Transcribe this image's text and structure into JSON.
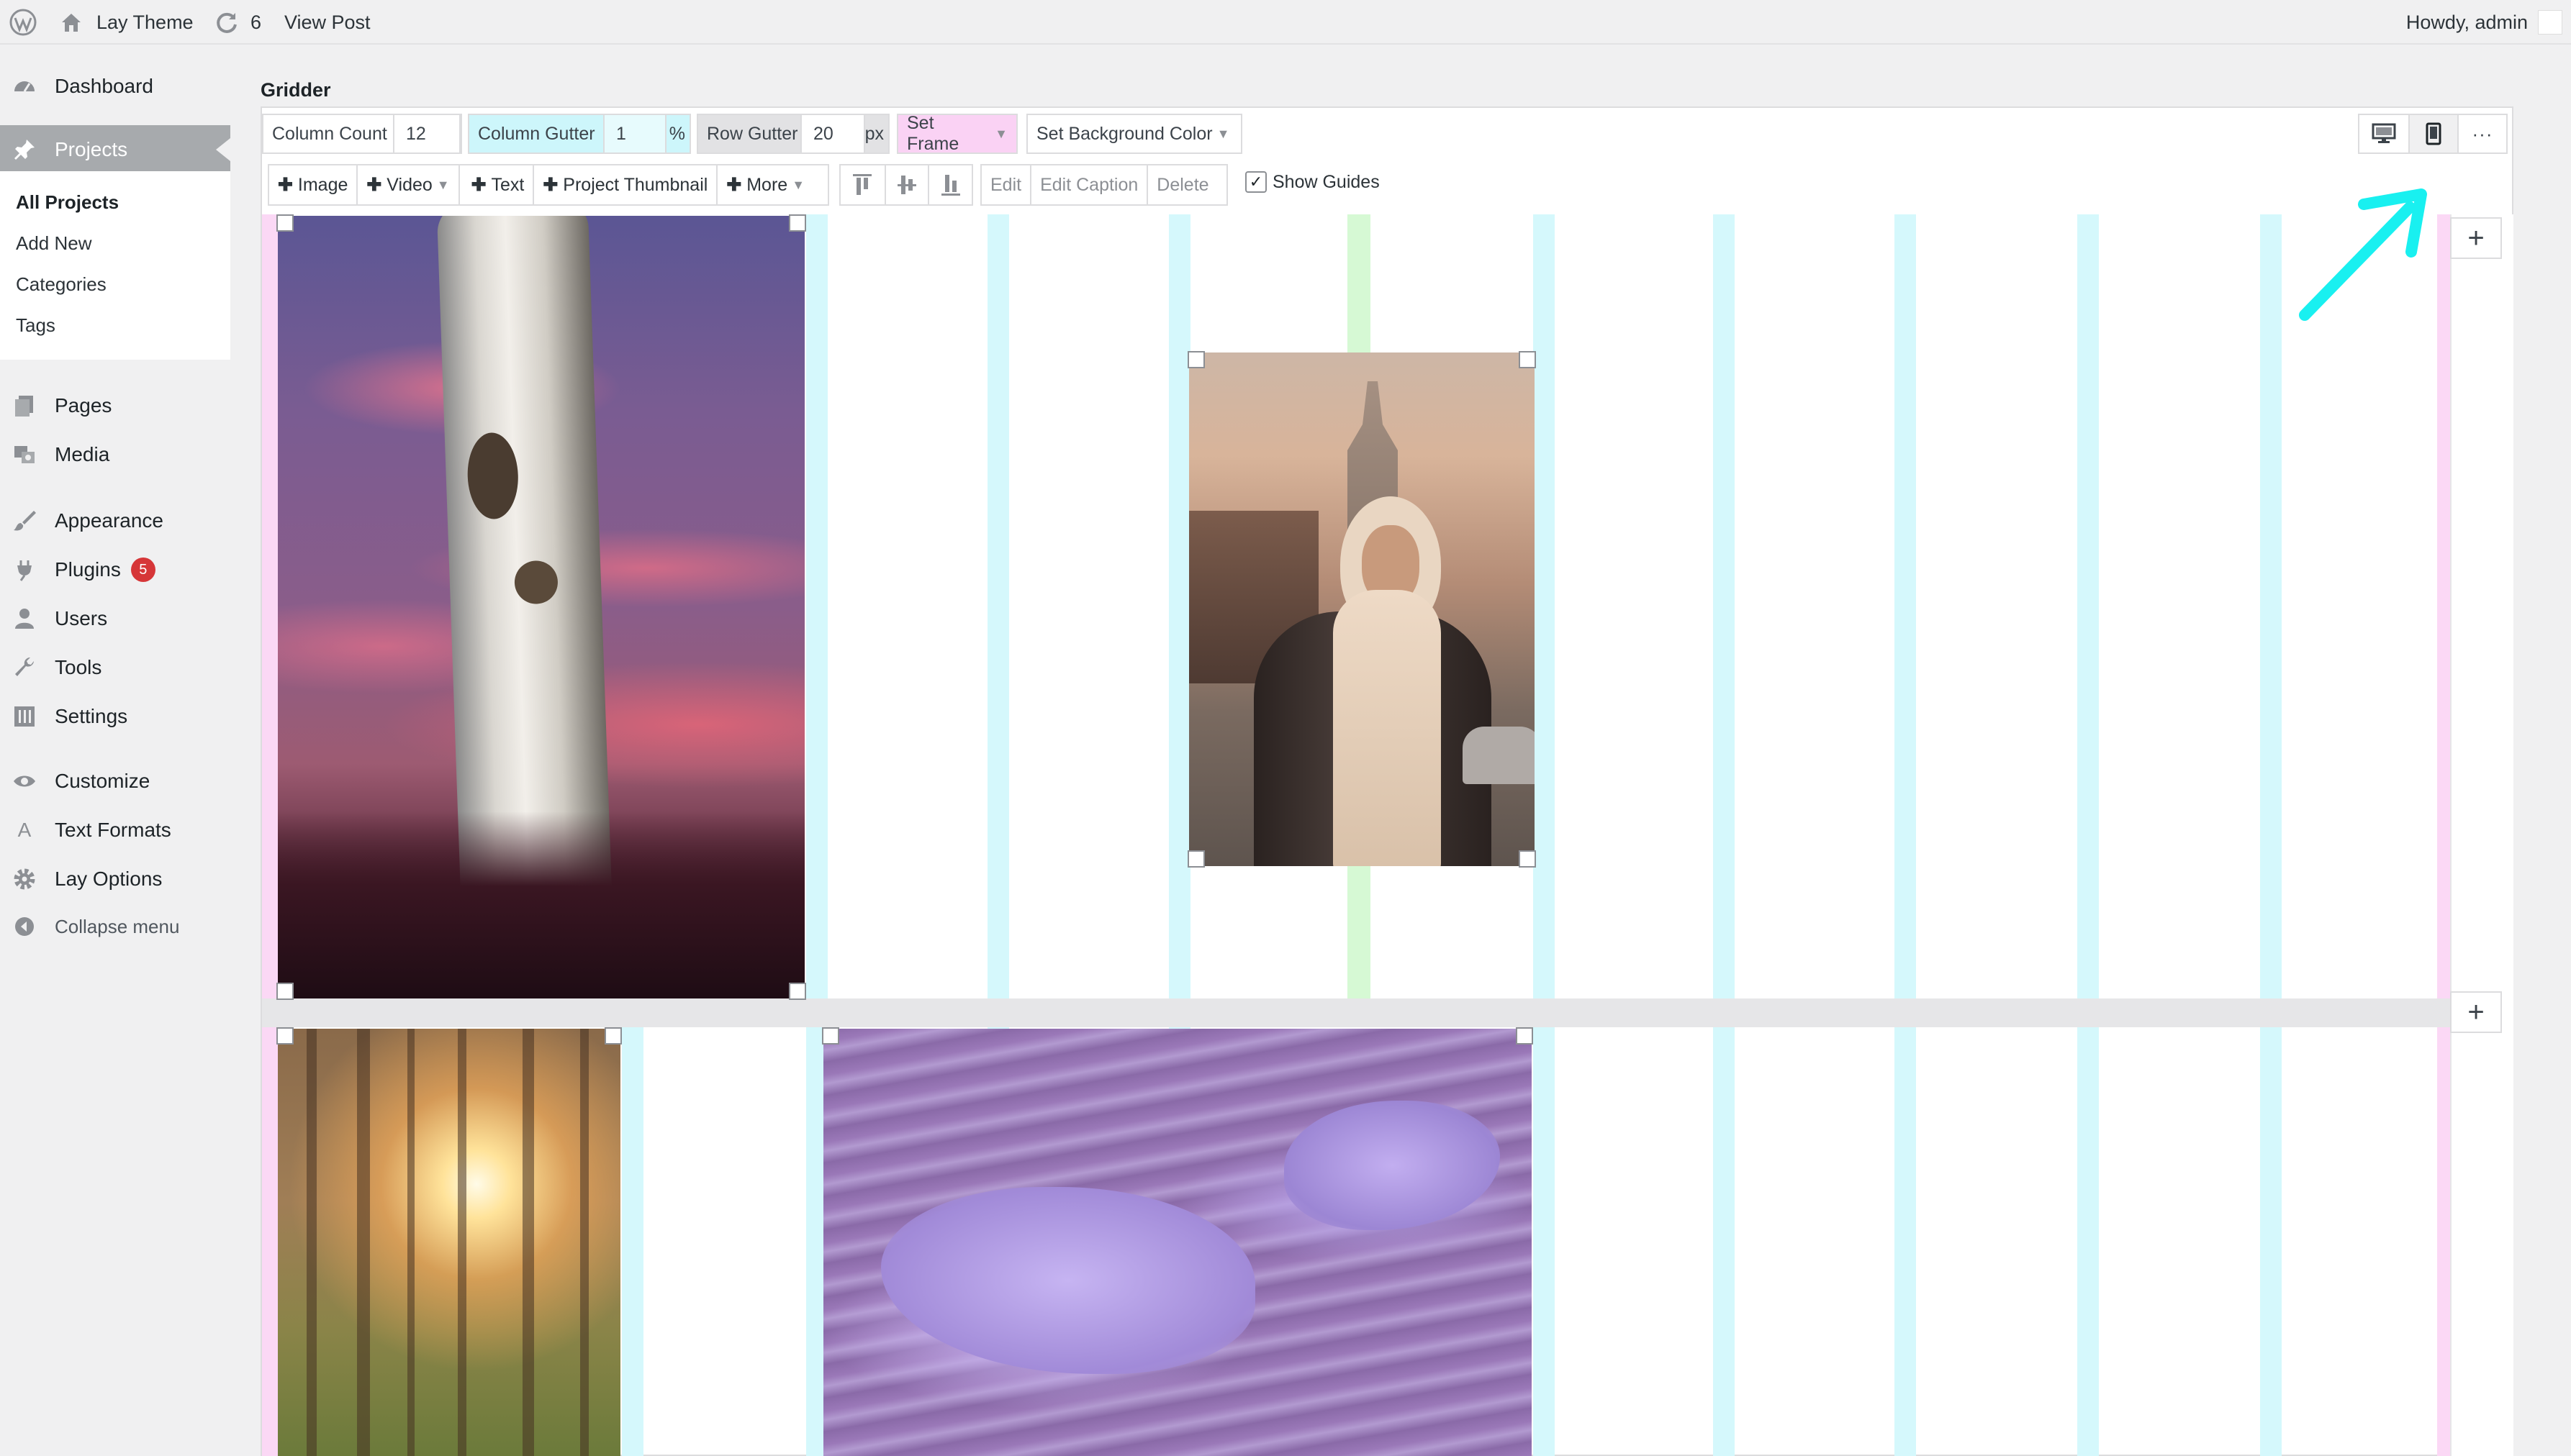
{
  "adminbar": {
    "site_name": "Lay Theme",
    "updates_count": "6",
    "view_post": "View Post",
    "howdy": "Howdy, admin"
  },
  "sidebar": {
    "dashboard": "Dashboard",
    "projects": "Projects",
    "submenu": [
      "All Projects",
      "Add New",
      "Categories",
      "Tags"
    ],
    "pages": "Pages",
    "media": "Media",
    "appearance": "Appearance",
    "plugins": "Plugins",
    "plugins_badge": "5",
    "users": "Users",
    "tools": "Tools",
    "settings": "Settings",
    "customize": "Customize",
    "text_formats": "Text Formats",
    "lay_options": "Lay Options",
    "collapse": "Collapse menu"
  },
  "gridder": {
    "title": "Gridder",
    "column_count_label": "Column Count",
    "column_count_value": "12",
    "column_gutter_label": "Column Gutter",
    "column_gutter_value": "1",
    "column_gutter_unit": "%",
    "row_gutter_label": "Row Gutter",
    "row_gutter_value": "20",
    "row_gutter_unit": "px",
    "set_frame": "Set Frame",
    "set_background_color": "Set Background Color",
    "add_image": "Image",
    "add_video": "Video",
    "add_text": "Text",
    "add_project_thumbnail": "Project Thumbnail",
    "add_more": "More",
    "edit": "Edit",
    "edit_caption": "Edit Caption",
    "delete": "Delete",
    "show_guides": "Show Guides",
    "show_guides_checked": true,
    "add_row_symbol": "+"
  },
  "colors": {
    "guide_cyan": "#d5f8fc",
    "guide_pink": "#fbd8f5",
    "guide_green": "#d6f9d4",
    "arrow": "#19f0f0",
    "active_menu": "#a7aaad"
  }
}
